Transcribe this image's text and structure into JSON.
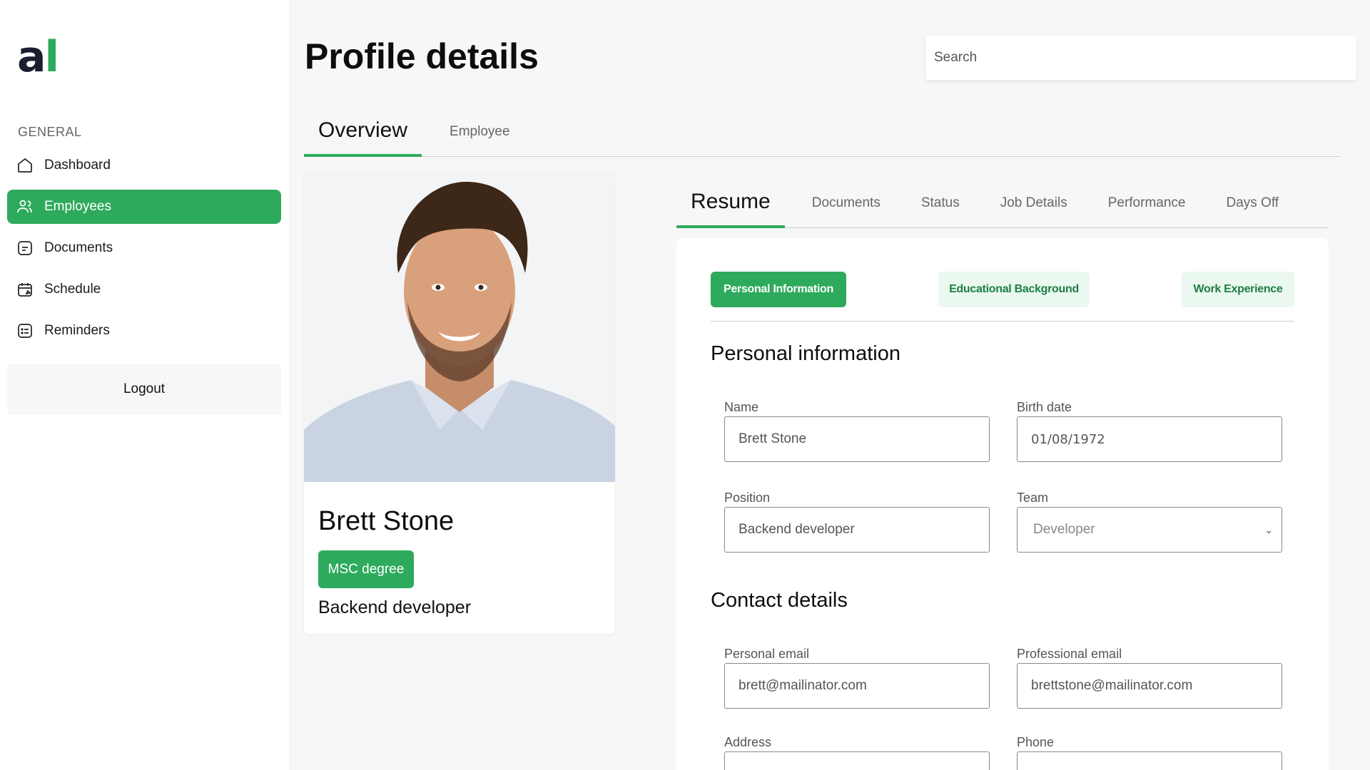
{
  "app": {
    "logo_primary": "a",
    "logo_accent": "l",
    "accent_color": "#2eaa5c"
  },
  "sidebar": {
    "section_label": "GENERAL",
    "items": [
      {
        "label": "Dashboard",
        "icon": "home-icon",
        "active": false
      },
      {
        "label": "Employees",
        "icon": "users-icon",
        "active": true
      },
      {
        "label": "Documents",
        "icon": "document-icon",
        "active": false
      },
      {
        "label": "Schedule",
        "icon": "calendar-icon",
        "active": false
      },
      {
        "label": "Reminders",
        "icon": "list-icon",
        "active": false
      }
    ],
    "logout_label": "Logout"
  },
  "header": {
    "title": "Profile details",
    "search_placeholder": "Search"
  },
  "top_tabs": [
    {
      "label": "Overview",
      "active": true
    },
    {
      "label": "Employee",
      "active": false
    }
  ],
  "profile": {
    "name": "Brett Stone",
    "degree": "MSC degree",
    "position": "Backend developer"
  },
  "sub_tabs": [
    {
      "label": "Resume",
      "active": true
    },
    {
      "label": "Documents",
      "active": false
    },
    {
      "label": "Status",
      "active": false
    },
    {
      "label": "Job Details",
      "active": false
    },
    {
      "label": "Performance",
      "active": false
    },
    {
      "label": "Days Off",
      "active": false
    }
  ],
  "resume_pills": [
    {
      "label": "Personal Information",
      "active": true
    },
    {
      "label": "Educational Background",
      "active": false
    },
    {
      "label": "Work Experience",
      "active": false
    }
  ],
  "personal": {
    "title": "Personal information",
    "name_label": "Name",
    "name_value": "Brett Stone",
    "birth_label": "Birth date",
    "birth_value": "01/08/1972",
    "position_label": "Position",
    "position_value": "Backend developer",
    "team_label": "Team",
    "team_value": "Developer"
  },
  "contact": {
    "title": "Contact details",
    "personal_email_label": "Personal email",
    "personal_email_value": "brett@mailinator.com",
    "professional_email_label": "Professional email",
    "professional_email_value": "brettstone@mailinator.com",
    "address_label": "Address",
    "phone_label": "Phone"
  }
}
